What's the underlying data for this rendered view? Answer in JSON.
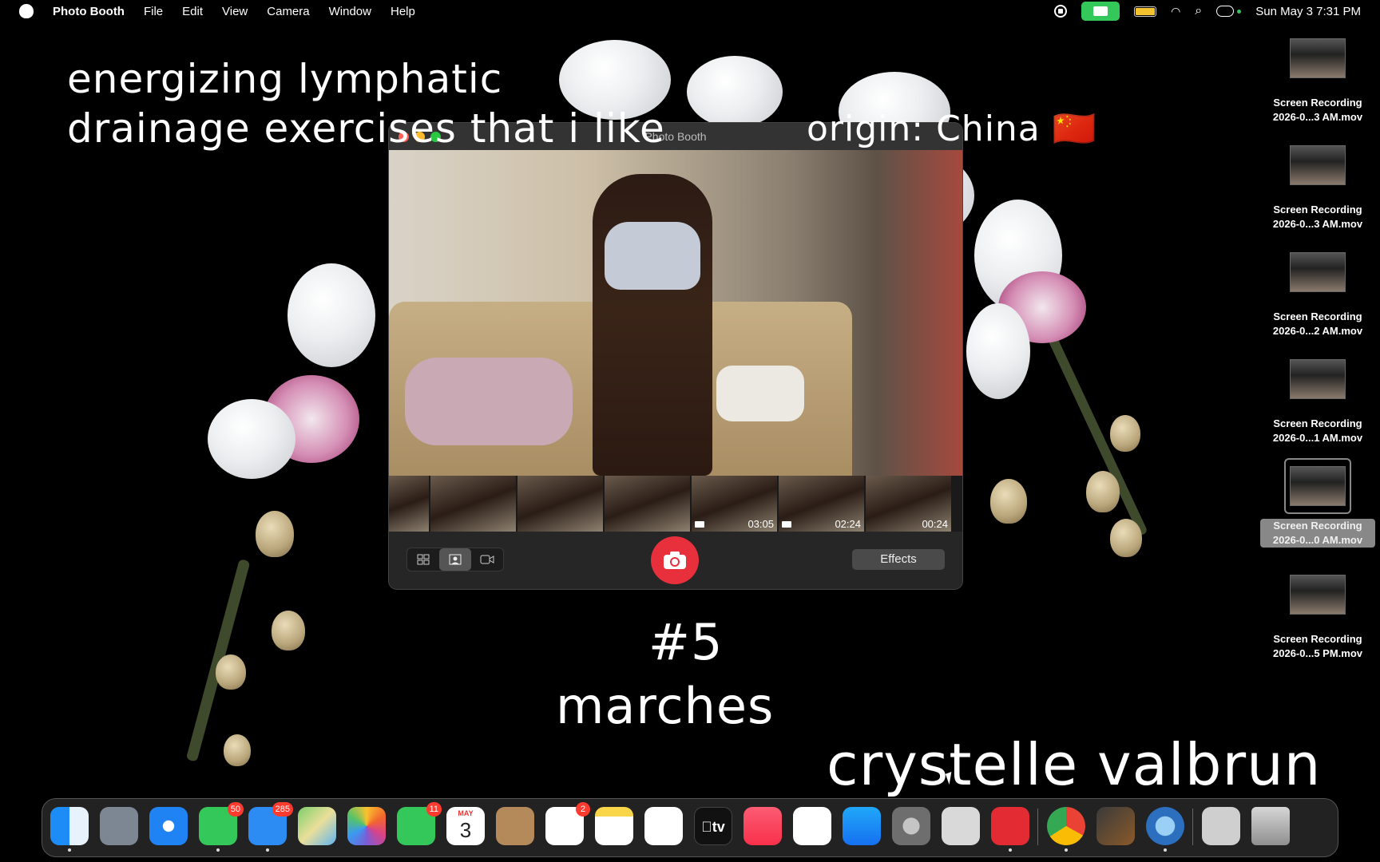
{
  "menubar": {
    "app_name": "Photo Booth",
    "menus": [
      "File",
      "Edit",
      "View",
      "Camera",
      "Window",
      "Help"
    ],
    "clock": "Sun May 3  7:31 PM"
  },
  "overlay": {
    "title_line1": "energizing lymphatic",
    "title_line2": "drainage exercises that i like",
    "origin": "origin: China 🇨🇳",
    "number": "#5",
    "exercise": "marches",
    "author": "crystelle valbrun"
  },
  "photobooth": {
    "window_title": "Photo Booth",
    "thumbnails": [
      {
        "duration": ""
      },
      {
        "duration": ""
      },
      {
        "duration": ""
      },
      {
        "duration": ""
      },
      {
        "duration": "03:05"
      },
      {
        "duration": "02:24"
      },
      {
        "duration": "00:24"
      }
    ],
    "effects_label": "Effects"
  },
  "desktop_files": [
    {
      "line1": "Screen Recording",
      "line2": "2026-0...3 AM.mov",
      "selected": false
    },
    {
      "line1": "Screen Recording",
      "line2": "2026-0...3 AM.mov",
      "selected": false
    },
    {
      "line1": "Screen Recording",
      "line2": "2026-0...2 AM.mov",
      "selected": false
    },
    {
      "line1": "Screen Recording",
      "line2": "2026-0...1 AM.mov",
      "selected": false
    },
    {
      "line1": "Screen Recording",
      "line2": "2026-0...0 AM.mov",
      "selected": true
    },
    {
      "line1": "Screen Recording",
      "line2": "2026-0...5 PM.mov",
      "selected": false
    }
  ],
  "dock": {
    "messages_badge": "50",
    "mail_badge": "285",
    "facetime_badge": "11",
    "reminders_badge": "2",
    "calendar_month": "MAY",
    "calendar_day": "3",
    "tv_label": "tv"
  },
  "colors": {
    "accent_green": "#34c759",
    "shutter_red": "#e8303c",
    "badge_red": "#ff3b30"
  }
}
